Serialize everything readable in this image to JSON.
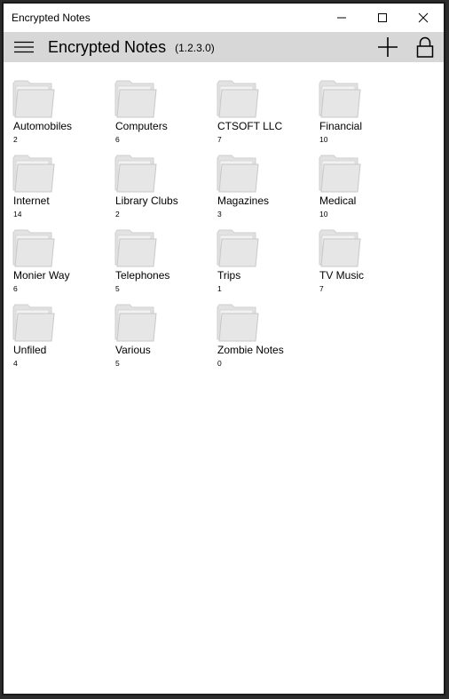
{
  "window": {
    "title": "Encrypted Notes"
  },
  "appbar": {
    "title": "Encrypted Notes",
    "version": "(1.2.3.0)"
  },
  "folders": [
    {
      "name": "Automobiles",
      "count": "2"
    },
    {
      "name": "Computers",
      "count": "6"
    },
    {
      "name": "CTSOFT LLC",
      "count": "7"
    },
    {
      "name": "Financial",
      "count": "10"
    },
    {
      "name": "Internet",
      "count": "14"
    },
    {
      "name": "Library Clubs",
      "count": "2"
    },
    {
      "name": "Magazines",
      "count": "3"
    },
    {
      "name": "Medical",
      "count": "10"
    },
    {
      "name": "Monier Way",
      "count": "6"
    },
    {
      "name": "Telephones",
      "count": "5"
    },
    {
      "name": "Trips",
      "count": "1"
    },
    {
      "name": "TV Music",
      "count": "7"
    },
    {
      "name": "Unfiled",
      "count": "4"
    },
    {
      "name": "Various",
      "count": "5"
    },
    {
      "name": "Zombie Notes",
      "count": "0"
    }
  ],
  "icons": {
    "menu": "hamburger-icon",
    "add": "plus-icon",
    "lock": "lock-icon",
    "folder": "folder-icon",
    "minimize": "minimize-icon",
    "maximize": "maximize-icon",
    "close": "close-icon"
  },
  "colors": {
    "appbar_bg": "#d7d7d7",
    "folder": "#e6e6e6",
    "window_bg": "#ffffff"
  }
}
